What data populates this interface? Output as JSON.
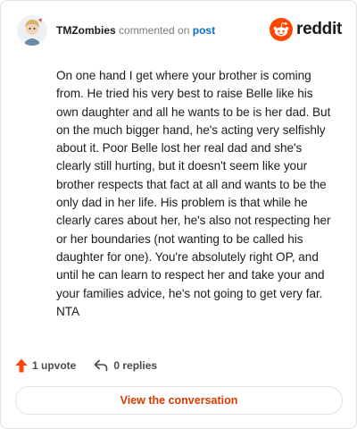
{
  "header": {
    "username": "TMZombies",
    "action_text": "commented on",
    "post_link": "post",
    "brand_name": "reddit",
    "brand_color": "#ff4500"
  },
  "comment": {
    "body": "On one hand I get where your brother is coming from. He tried his very best to raise Belle like his own daughter and all he wants to be is her dad. But on the much bigger hand, he's acting very selfishly about it. Poor Belle lost her real dad and she's clearly still hurting, but it doesn't seem like your brother respects that fact at all and wants to be the only dad in her life. His problem is that while he clearly cares about her, he's also not respecting her or her boundaries (not wanting to be called his daughter for one). You're absolutely right OP, and until he can learn to respect her and take your and your families advice, he's not going to get very far. NTA"
  },
  "actions": {
    "upvote_label": "1 upvote",
    "upvote_icon": "upvote-arrow-icon",
    "upvote_color": "#ff4500",
    "replies_label": "0 replies",
    "replies_icon": "reply-arrow-icon"
  },
  "cta": {
    "label": "View the conversation",
    "color": "#d93a00"
  }
}
